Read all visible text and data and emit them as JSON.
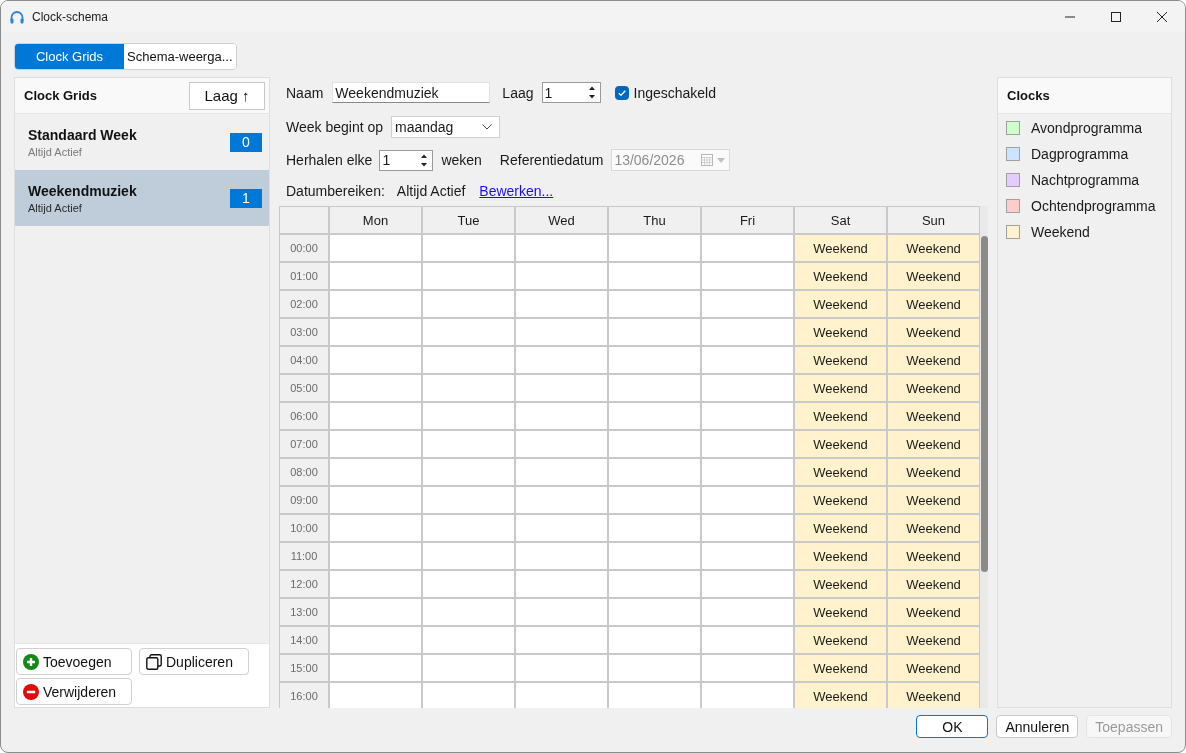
{
  "window": {
    "title": "Clock-schema"
  },
  "tabs": [
    {
      "label": "Clock Grids",
      "selected": true
    },
    {
      "label": "Schema-weerga...",
      "selected": false
    }
  ],
  "clock_grids": {
    "title": "Clock Grids",
    "sort_button": "Laag ↑",
    "items": [
      {
        "name": "Standaard Week",
        "subtitle": "Altijd Actief",
        "badge": "0",
        "selected": false
      },
      {
        "name": "Weekendmuziek",
        "subtitle": "Altijd Actief",
        "badge": "1",
        "selected": true
      }
    ],
    "buttons": [
      {
        "kind": "add",
        "label": "Toevoegen"
      },
      {
        "kind": "duplicate",
        "label": "Dupliceren"
      },
      {
        "kind": "remove",
        "label": "Verwijderen"
      }
    ]
  },
  "form": {
    "name": {
      "label": "Naam",
      "value": "Weekendmuziek"
    },
    "layer": {
      "label": "Laag",
      "value": "1"
    },
    "enabled": {
      "label": "Ingeschakeld",
      "checked": true
    },
    "week_start": {
      "label": "Week begint op",
      "value": "maandag"
    },
    "repeat": {
      "label": "Herhalen elke",
      "value": "1",
      "unit": "weken"
    },
    "reference_date": {
      "label": "Referentiedatum",
      "value": "13/06/2026",
      "disabled": true
    },
    "date_ranges": {
      "label": "Datumbereiken:",
      "value": "Altijd Actief",
      "link": "Bewerken..."
    }
  },
  "grid": {
    "columns": [
      "Mon",
      "Tue",
      "Wed",
      "Thu",
      "Fri",
      "Sat",
      "Sun"
    ],
    "rows": [
      {
        "time": "00:00",
        "cells": [
          {
            "kind": "empty"
          },
          {
            "kind": "empty"
          },
          {
            "kind": "empty"
          },
          {
            "kind": "empty"
          },
          {
            "kind": "empty"
          },
          {
            "kind": "clock",
            "label": "Weekend",
            "color": "#fff2cc"
          },
          {
            "kind": "clock",
            "label": "Weekend",
            "color": "#fff2cc"
          }
        ]
      },
      {
        "time": "01:00",
        "cells": [
          {
            "kind": "empty"
          },
          {
            "kind": "empty"
          },
          {
            "kind": "empty"
          },
          {
            "kind": "empty"
          },
          {
            "kind": "empty"
          },
          {
            "kind": "clock",
            "label": "Weekend",
            "color": "#fff2cc"
          },
          {
            "kind": "clock",
            "label": "Weekend",
            "color": "#fff2cc"
          }
        ]
      },
      {
        "time": "02:00",
        "cells": [
          {
            "kind": "empty"
          },
          {
            "kind": "empty"
          },
          {
            "kind": "empty"
          },
          {
            "kind": "empty"
          },
          {
            "kind": "empty"
          },
          {
            "kind": "clock",
            "label": "Weekend",
            "color": "#fff2cc"
          },
          {
            "kind": "clock",
            "label": "Weekend",
            "color": "#fff2cc"
          }
        ]
      },
      {
        "time": "03:00",
        "cells": [
          {
            "kind": "empty"
          },
          {
            "kind": "empty"
          },
          {
            "kind": "empty"
          },
          {
            "kind": "empty"
          },
          {
            "kind": "empty"
          },
          {
            "kind": "clock",
            "label": "Weekend",
            "color": "#fff2cc"
          },
          {
            "kind": "clock",
            "label": "Weekend",
            "color": "#fff2cc"
          }
        ]
      },
      {
        "time": "04:00",
        "cells": [
          {
            "kind": "empty"
          },
          {
            "kind": "empty"
          },
          {
            "kind": "empty"
          },
          {
            "kind": "empty"
          },
          {
            "kind": "empty"
          },
          {
            "kind": "clock",
            "label": "Weekend",
            "color": "#fff2cc"
          },
          {
            "kind": "clock",
            "label": "Weekend",
            "color": "#fff2cc"
          }
        ]
      },
      {
        "time": "05:00",
        "cells": [
          {
            "kind": "empty"
          },
          {
            "kind": "empty"
          },
          {
            "kind": "empty"
          },
          {
            "kind": "empty"
          },
          {
            "kind": "empty"
          },
          {
            "kind": "clock",
            "label": "Weekend",
            "color": "#fff2cc"
          },
          {
            "kind": "clock",
            "label": "Weekend",
            "color": "#fff2cc"
          }
        ]
      },
      {
        "time": "06:00",
        "cells": [
          {
            "kind": "empty"
          },
          {
            "kind": "empty"
          },
          {
            "kind": "empty"
          },
          {
            "kind": "empty"
          },
          {
            "kind": "empty"
          },
          {
            "kind": "clock",
            "label": "Weekend",
            "color": "#fff2cc"
          },
          {
            "kind": "clock",
            "label": "Weekend",
            "color": "#fff2cc"
          }
        ]
      },
      {
        "time": "07:00",
        "cells": [
          {
            "kind": "empty"
          },
          {
            "kind": "empty"
          },
          {
            "kind": "empty"
          },
          {
            "kind": "empty"
          },
          {
            "kind": "empty"
          },
          {
            "kind": "clock",
            "label": "Weekend",
            "color": "#fff2cc"
          },
          {
            "kind": "clock",
            "label": "Weekend",
            "color": "#fff2cc"
          }
        ]
      },
      {
        "time": "08:00",
        "cells": [
          {
            "kind": "empty"
          },
          {
            "kind": "empty"
          },
          {
            "kind": "empty"
          },
          {
            "kind": "empty"
          },
          {
            "kind": "empty"
          },
          {
            "kind": "clock",
            "label": "Weekend",
            "color": "#fff2cc"
          },
          {
            "kind": "clock",
            "label": "Weekend",
            "color": "#fff2cc"
          }
        ]
      },
      {
        "time": "09:00",
        "cells": [
          {
            "kind": "empty"
          },
          {
            "kind": "empty"
          },
          {
            "kind": "empty"
          },
          {
            "kind": "empty"
          },
          {
            "kind": "empty"
          },
          {
            "kind": "clock",
            "label": "Weekend",
            "color": "#fff2cc"
          },
          {
            "kind": "clock",
            "label": "Weekend",
            "color": "#fff2cc"
          }
        ]
      },
      {
        "time": "10:00",
        "cells": [
          {
            "kind": "empty"
          },
          {
            "kind": "empty"
          },
          {
            "kind": "empty"
          },
          {
            "kind": "empty"
          },
          {
            "kind": "empty"
          },
          {
            "kind": "clock",
            "label": "Weekend",
            "color": "#fff2cc"
          },
          {
            "kind": "clock",
            "label": "Weekend",
            "color": "#fff2cc"
          }
        ]
      },
      {
        "time": "11:00",
        "cells": [
          {
            "kind": "empty"
          },
          {
            "kind": "empty"
          },
          {
            "kind": "empty"
          },
          {
            "kind": "empty"
          },
          {
            "kind": "empty"
          },
          {
            "kind": "clock",
            "label": "Weekend",
            "color": "#fff2cc"
          },
          {
            "kind": "clock",
            "label": "Weekend",
            "color": "#fff2cc"
          }
        ]
      },
      {
        "time": "12:00",
        "cells": [
          {
            "kind": "empty"
          },
          {
            "kind": "empty"
          },
          {
            "kind": "empty"
          },
          {
            "kind": "empty"
          },
          {
            "kind": "empty"
          },
          {
            "kind": "clock",
            "label": "Weekend",
            "color": "#fff2cc"
          },
          {
            "kind": "clock",
            "label": "Weekend",
            "color": "#fff2cc"
          }
        ]
      },
      {
        "time": "13:00",
        "cells": [
          {
            "kind": "empty"
          },
          {
            "kind": "empty"
          },
          {
            "kind": "empty"
          },
          {
            "kind": "empty"
          },
          {
            "kind": "empty"
          },
          {
            "kind": "clock",
            "label": "Weekend",
            "color": "#fff2cc"
          },
          {
            "kind": "clock",
            "label": "Weekend",
            "color": "#fff2cc"
          }
        ]
      },
      {
        "time": "14:00",
        "cells": [
          {
            "kind": "empty"
          },
          {
            "kind": "empty"
          },
          {
            "kind": "empty"
          },
          {
            "kind": "empty"
          },
          {
            "kind": "empty"
          },
          {
            "kind": "clock",
            "label": "Weekend",
            "color": "#fff2cc"
          },
          {
            "kind": "clock",
            "label": "Weekend",
            "color": "#fff2cc"
          }
        ]
      },
      {
        "time": "15:00",
        "cells": [
          {
            "kind": "empty"
          },
          {
            "kind": "empty"
          },
          {
            "kind": "empty"
          },
          {
            "kind": "empty"
          },
          {
            "kind": "empty"
          },
          {
            "kind": "clock",
            "label": "Weekend",
            "color": "#fff2cc"
          },
          {
            "kind": "clock",
            "label": "Weekend",
            "color": "#fff2cc"
          }
        ]
      },
      {
        "time": "16:00",
        "cells": [
          {
            "kind": "empty"
          },
          {
            "kind": "empty"
          },
          {
            "kind": "empty"
          },
          {
            "kind": "empty"
          },
          {
            "kind": "empty"
          },
          {
            "kind": "clock",
            "label": "Weekend",
            "color": "#fff2cc"
          },
          {
            "kind": "clock",
            "label": "Weekend",
            "color": "#fff2cc"
          }
        ]
      }
    ]
  },
  "clocks": {
    "title": "Clocks",
    "items": [
      {
        "name": "Avondprogramma",
        "color": "#ccffcc"
      },
      {
        "name": "Dagprogramma",
        "color": "#cce5ff"
      },
      {
        "name": "Nachtprogramma",
        "color": "#e5ccff"
      },
      {
        "name": "Ochtendprogramma",
        "color": "#ffcccc"
      },
      {
        "name": "Weekend",
        "color": "#fff2cc"
      }
    ]
  },
  "footer_buttons": [
    {
      "label": "OK",
      "kind": "default",
      "disabled": false
    },
    {
      "label": "Annuleren",
      "kind": "normal",
      "disabled": false
    },
    {
      "label": "Toepassen",
      "kind": "normal",
      "disabled": true
    }
  ]
}
